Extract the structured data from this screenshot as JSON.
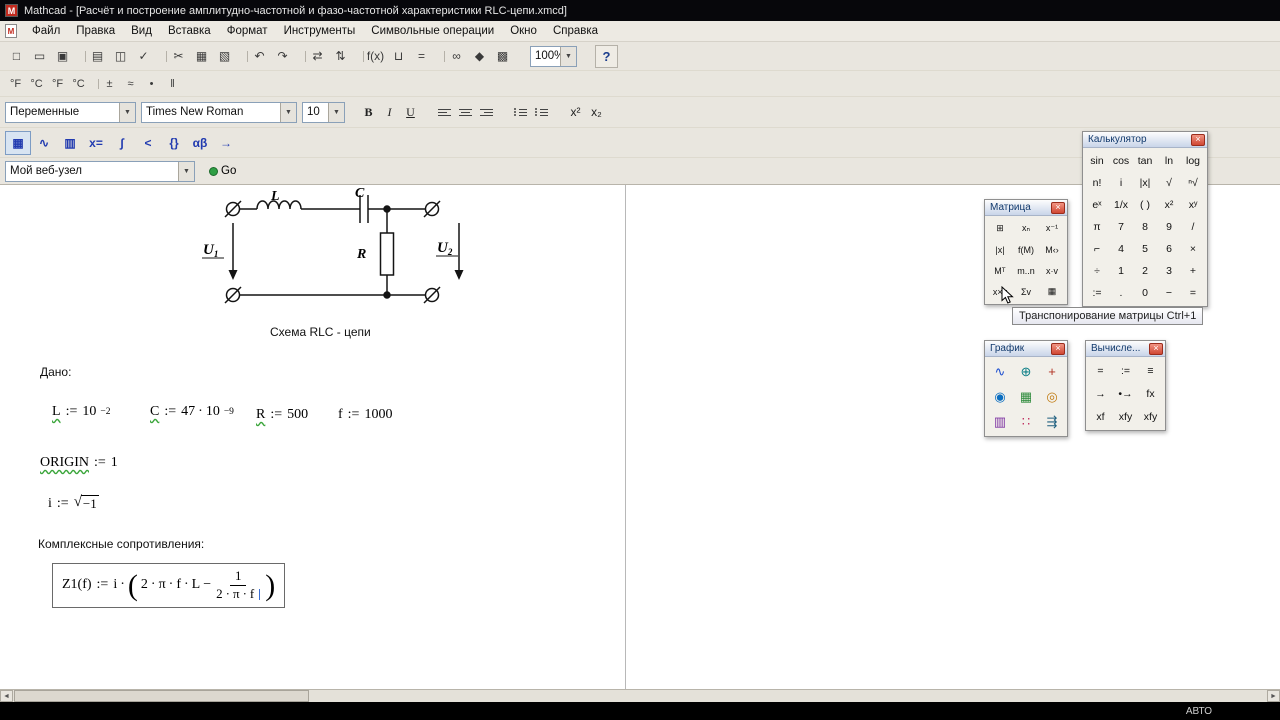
{
  "window": {
    "title": "Mathcad - [Расчёт и построение амплитудно-частотной и фазо-частотной характеристики RLC-цепи.xmcd]",
    "app_initial": "M",
    "doc_initial": "M",
    "status_right": "АВТО"
  },
  "menu_bar": {
    "items": [
      "Файл",
      "Правка",
      "Вид",
      "Вставка",
      "Формат",
      "Инструменты",
      "Символьные операции",
      "Окно",
      "Справка"
    ]
  },
  "standard_toolbar": {
    "zoom_value": "100%",
    "help_label": "?",
    "icons": [
      {
        "name": "new-icon",
        "glyph": "□"
      },
      {
        "name": "open-icon",
        "glyph": "▭"
      },
      {
        "name": "save-icon",
        "glyph": "▣"
      },
      {
        "name": "print-icon",
        "glyph": "▤"
      },
      {
        "name": "print-preview-icon",
        "glyph": "◫"
      },
      {
        "name": "spell-check-icon",
        "glyph": "✓"
      },
      {
        "name": "cut-icon",
        "glyph": "✂"
      },
      {
        "name": "copy-icon",
        "glyph": "▦"
      },
      {
        "name": "paste-icon",
        "glyph": "▧"
      },
      {
        "name": "undo-icon",
        "glyph": "↶"
      },
      {
        "name": "redo-icon",
        "glyph": "↷"
      },
      {
        "name": "align-across-icon",
        "glyph": "⇄"
      },
      {
        "name": "align-down-icon",
        "glyph": "⇅"
      },
      {
        "name": "insert-function-icon",
        "glyph": "f(x)"
      },
      {
        "name": "insert-unit-icon",
        "glyph": "⊔"
      },
      {
        "name": "calculate-icon",
        "glyph": "="
      },
      {
        "name": "hyperlink-icon",
        "glyph": "∞"
      },
      {
        "name": "component-icon",
        "glyph": "◆"
      },
      {
        "name": "zoom-area-icon",
        "glyph": "▩"
      }
    ]
  },
  "custom_toolbar": {
    "buttons": [
      "°F",
      "°C",
      "°F",
      "°C",
      "±",
      "≈",
      "•",
      "‖"
    ]
  },
  "format_toolbar": {
    "style_value": "Переменные",
    "font_value": "Times New Roman",
    "size_value": "10",
    "bold": "B",
    "italic": "I",
    "underline": "U",
    "superscript": "x²",
    "subscript": "x₂"
  },
  "math_toolbar": {
    "icons": [
      {
        "name": "calculator-palette-icon",
        "glyph": "▦"
      },
      {
        "name": "graph-palette-icon",
        "glyph": "∿"
      },
      {
        "name": "matrix-palette-icon",
        "glyph": "▥"
      },
      {
        "name": "evaluation-palette-icon",
        "glyph": "x="
      },
      {
        "name": "calculus-palette-icon",
        "glyph": "∫"
      },
      {
        "name": "boolean-palette-icon",
        "glyph": "<"
      },
      {
        "name": "programming-palette-icon",
        "glyph": "{}"
      },
      {
        "name": "greek-palette-icon",
        "glyph": "αβ"
      },
      {
        "name": "symbolic-palette-icon",
        "glyph": "→"
      }
    ]
  },
  "web_toolbar": {
    "address_value": "Мой веб-узел",
    "go_label": "Go"
  },
  "ui": {
    "dropdown_arrow": "▼",
    "scroll_left": "◄",
    "scroll_right": "►",
    "close_glyph": "×"
  },
  "worksheet": {
    "circuit": {
      "caption": "Схема RLC - цепи",
      "label_l": "L",
      "label_c": "C",
      "label_r": "R",
      "label_u": "U",
      "u1_sub": "1",
      "u2_sub": "2"
    },
    "given_label": "Дано:",
    "def_l": {
      "lhs": "L",
      "op": ":=",
      "base": "10",
      "exp": "−2"
    },
    "def_c": {
      "lhs": "C",
      "op": ":=",
      "coef": "47",
      "dot": "·",
      "base": "10",
      "exp": "−9"
    },
    "def_r": {
      "lhs": "R",
      "op": ":=",
      "value": "500"
    },
    "def_f": {
      "lhs": "f",
      "op": ":=",
      "value": "1000"
    },
    "origin_def": {
      "lhs": "ORIGIN",
      "op": ":=",
      "value": "1"
    },
    "i_def": {
      "lhs": "i",
      "op": ":=",
      "sqrt": "√",
      "radicand": "−1"
    },
    "impedance_label": "Комплексные сопротивления:",
    "z1": {
      "lhs": "Z1(f)",
      "op": ":=",
      "factor": "i",
      "dot": "·",
      "lparen": "(",
      "rparen": ")",
      "t1": "2",
      "t2": "π",
      "t3": "f",
      "t4": "L",
      "minus": "−",
      "num": "1",
      "d1": "2",
      "d2": "π",
      "d3": "f"
    }
  },
  "palettes": {
    "calculator": {
      "title": "Калькулятор",
      "buttons": [
        "sin",
        "cos",
        "tan",
        "ln",
        "log",
        "n!",
        "i",
        "|x|",
        "√",
        "ⁿ√",
        "eˣ",
        "1/x",
        "( )",
        "x²",
        "xʸ",
        "π",
        "7",
        "8",
        "9",
        "/",
        "⌐",
        "4",
        "5",
        "6",
        "×",
        "÷",
        "1",
        "2",
        "3",
        "+",
        ":=",
        ".",
        "0",
        "−",
        "="
      ]
    },
    "matrix": {
      "title": "Матрица",
      "buttons": [
        "⊞",
        "xₙ",
        "x⁻¹",
        "|x|",
        "f(M)",
        "M‹›",
        "Mᵀ",
        "m..n",
        "x·v",
        "x×v",
        "Σv",
        "▦"
      ]
    },
    "graph": {
      "title": "График",
      "buttons": [
        "∿",
        "⊕",
        "+",
        "◉",
        "▦",
        "◎",
        "▥",
        "∷",
        "⇶"
      ]
    },
    "evaluation": {
      "title": "Вычисле...",
      "buttons": [
        "=",
        ":=",
        "≡",
        "→",
        "•→",
        "fx",
        "xf",
        "xfy",
        "xfy"
      ]
    }
  },
  "tooltip": {
    "text": "Транспонирование матрицы Ctrl+1"
  }
}
